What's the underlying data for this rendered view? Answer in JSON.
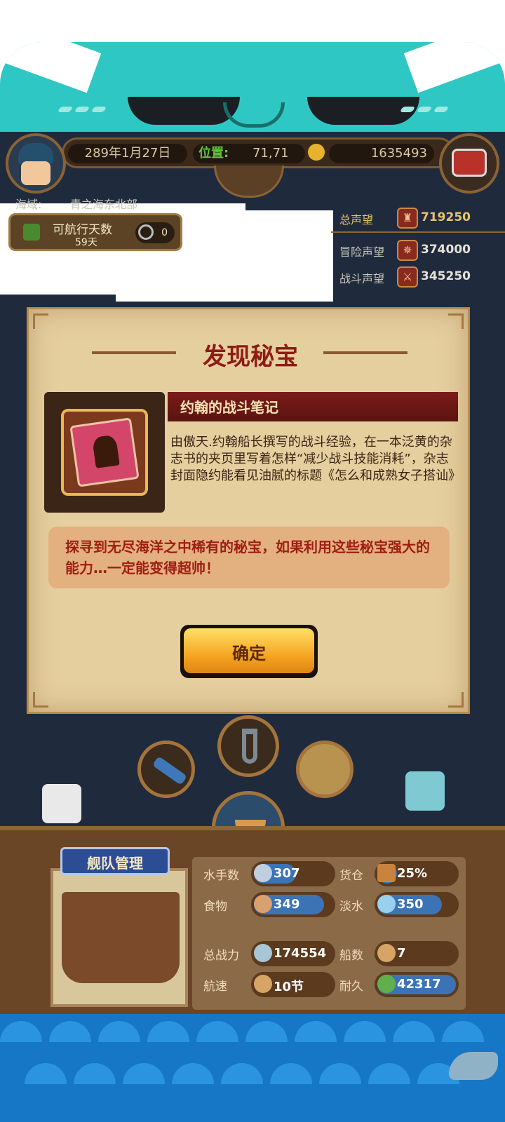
{
  "topbar": {
    "date": "289年1月27日",
    "position_label": "位置:",
    "position_value": "71,71",
    "gold": "1635493"
  },
  "region": {
    "label": "海域:",
    "value": "青之海东北部"
  },
  "sailing": {
    "label": "可航行天数",
    "days": "59天",
    "counter": "0"
  },
  "reputation": {
    "total_label": "总声望",
    "total_value": "719250",
    "adventure_label": "冒险声望",
    "adventure_value": "374000",
    "battle_label": "战斗声望",
    "battle_value": "345250"
  },
  "dialog": {
    "title": "发现秘宝",
    "item_name": "约翰的战斗笔记",
    "item_desc": "由傲天.约翰船长撰写的战斗经验，在一本泛黄的杂志书的夹页里写着怎样“减少战斗技能消耗”，杂志封面隐约能看见油腻的标题《怎么和成熟女子搭讪》",
    "hint": "探寻到无尽海洋之中稀有的秘宝，如果利用这些秘宝强大的能力…一定能变得超帅！",
    "ok": "确定"
  },
  "fleet": {
    "title": "舰队管理",
    "stats": {
      "sailors_label": "水手数",
      "sailors": "307",
      "cargo_label": "货仓",
      "cargo": "25%",
      "food_label": "食物",
      "food": "349",
      "water_label": "淡水",
      "water": "350",
      "power_label": "总战力",
      "power": "174554",
      "ships_label": "船数",
      "ships": "7",
      "speed_label": "航速",
      "speed": "10节",
      "durability_label": "耐久",
      "durability": "42317"
    }
  },
  "colors": {
    "accent_red": "#8e1b14",
    "teal": "#2fc7c4",
    "gold_text": "#e8c46a"
  }
}
